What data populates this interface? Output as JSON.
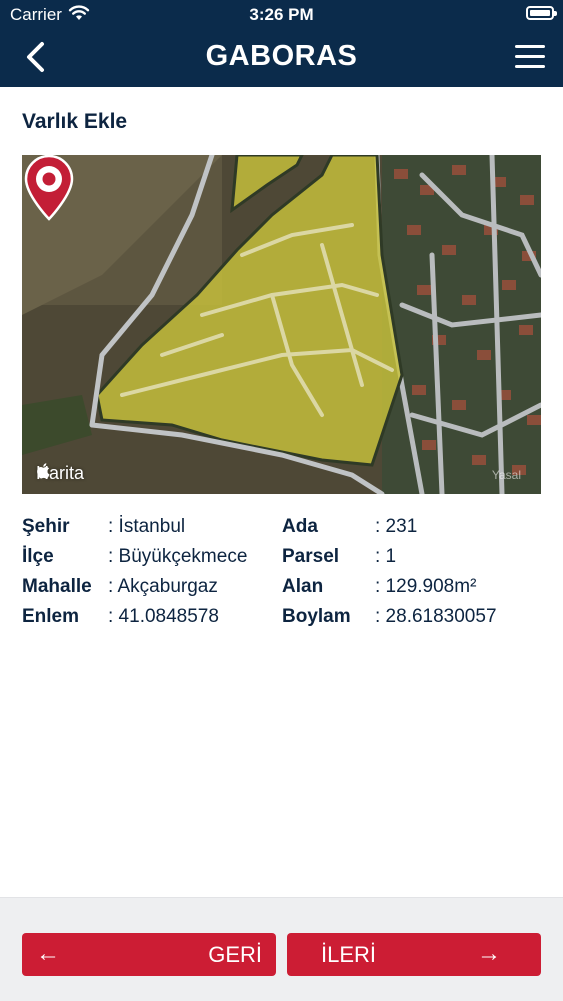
{
  "status_bar": {
    "carrier": "Carrier",
    "time": "3:26 PM"
  },
  "header": {
    "title": "GABORAS"
  },
  "page": {
    "section_title": "Varlık Ekle"
  },
  "map": {
    "attribution": "Harita",
    "legal": "Yasal"
  },
  "info": {
    "left": [
      {
        "label": "Şehir",
        "value": ": İstanbul"
      },
      {
        "label": "İlçe",
        "value": ": Büyükçekmece"
      },
      {
        "label": "Mahalle",
        "value": ": Akçaburgaz"
      },
      {
        "label": "Enlem",
        "value": ": 41.0848578"
      }
    ],
    "right": [
      {
        "label": "Ada",
        "value": ": 231"
      },
      {
        "label": "Parsel",
        "value": ": 1"
      },
      {
        "label": "Alan",
        "value": ": 129.908m²"
      },
      {
        "label": "Boylam",
        "value": ": 28.61830057"
      }
    ]
  },
  "footer": {
    "back_label": "GERİ",
    "back_arrow": "←",
    "next_label": "İLERİ",
    "next_arrow": "→"
  },
  "colors": {
    "header": "#0b2b4b",
    "accent": "#cc1d34",
    "parcel": "#c8c23c"
  },
  "icons": [
    "wifi-icon",
    "battery-icon",
    "chevron-left-icon",
    "hamburger-menu-icon",
    "map-pin-icon",
    "apple-logo-icon"
  ]
}
